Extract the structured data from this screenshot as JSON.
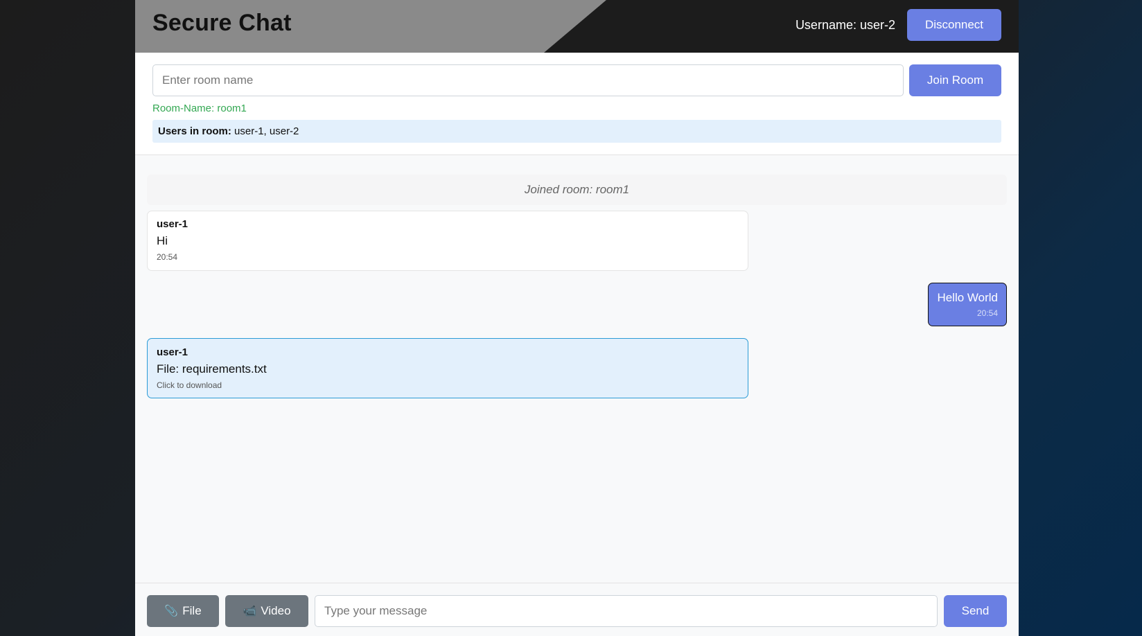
{
  "header": {
    "title": "Secure Chat",
    "username_text": "Username: user-2",
    "disconnect_label": "Disconnect"
  },
  "room": {
    "input_placeholder": "Enter room name",
    "join_label": "Join Room",
    "room_name_text": "Room-Name: room1",
    "users_label": "Users in room:",
    "users_value": " user-1, user-2"
  },
  "messages": {
    "system": "Joined room: room1",
    "items": [
      {
        "sender": "user-1",
        "text": "Hi",
        "time": "20:54"
      },
      {
        "text": "Hello World",
        "time": "20:54"
      },
      {
        "sender": "user-1",
        "text": "File: requirements.txt",
        "hint": "Click to download"
      }
    ]
  },
  "input_bar": {
    "file_label": "File",
    "file_icon": "paperclip-icon",
    "video_label": "Video",
    "video_icon": "video-camera-icon",
    "message_placeholder": "Type your message",
    "send_label": "Send"
  },
  "colors": {
    "accent": "#6a7fe3",
    "secondary": "#6c757d",
    "room_name": "#34a853",
    "users_bg": "#e3f0fc",
    "file_border": "#2b9bd6"
  }
}
